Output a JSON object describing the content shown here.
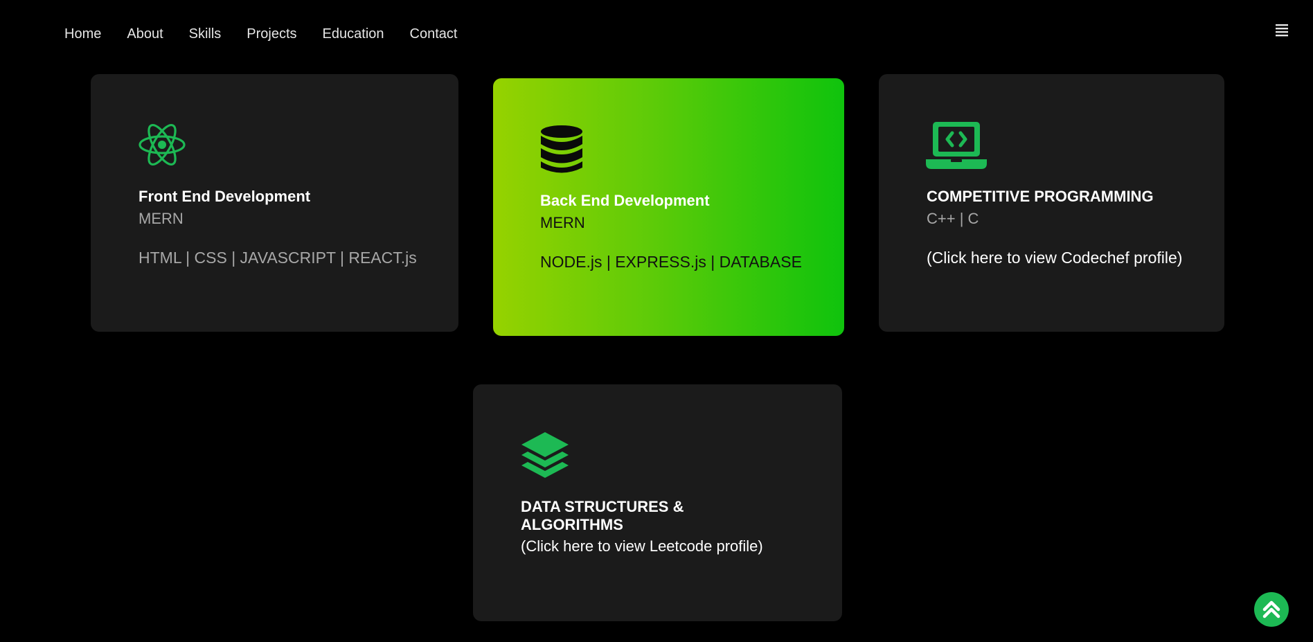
{
  "nav": {
    "items": [
      "Home",
      "About",
      "Skills",
      "Projects",
      "Education",
      "Contact"
    ]
  },
  "colors": {
    "background": "#000000",
    "card": "#1b1b1b",
    "accent_green": "#1db954",
    "gradient_start": "#96d200",
    "gradient_end": "#0fc30d"
  },
  "cards": [
    {
      "icon": "react-atom-icon",
      "title": "Front End Development",
      "subtitle": "MERN",
      "detail": "HTML | CSS | JAVASCRIPT | REACT.js"
    },
    {
      "icon": "database-icon",
      "title": "Back End Development",
      "subtitle": "MERN",
      "detail": "NODE.js | EXPRESS.js | DATABASE"
    },
    {
      "icon": "laptop-code-icon",
      "title": "COMPETITIVE PROGRAMMING",
      "subtitle": "C++ | C",
      "detail": "(Click here to view Codechef profile)"
    },
    {
      "icon": "layers-icon",
      "title_line1": "DATA STRUCTURES &",
      "title_line2": "ALGORITHMS",
      "detail": "(Click here to view Leetcode profile)"
    }
  ],
  "controls": {
    "menu_icon": "hamburger-menu-icon",
    "scroll_top_icon": "double-chevron-up-icon"
  }
}
